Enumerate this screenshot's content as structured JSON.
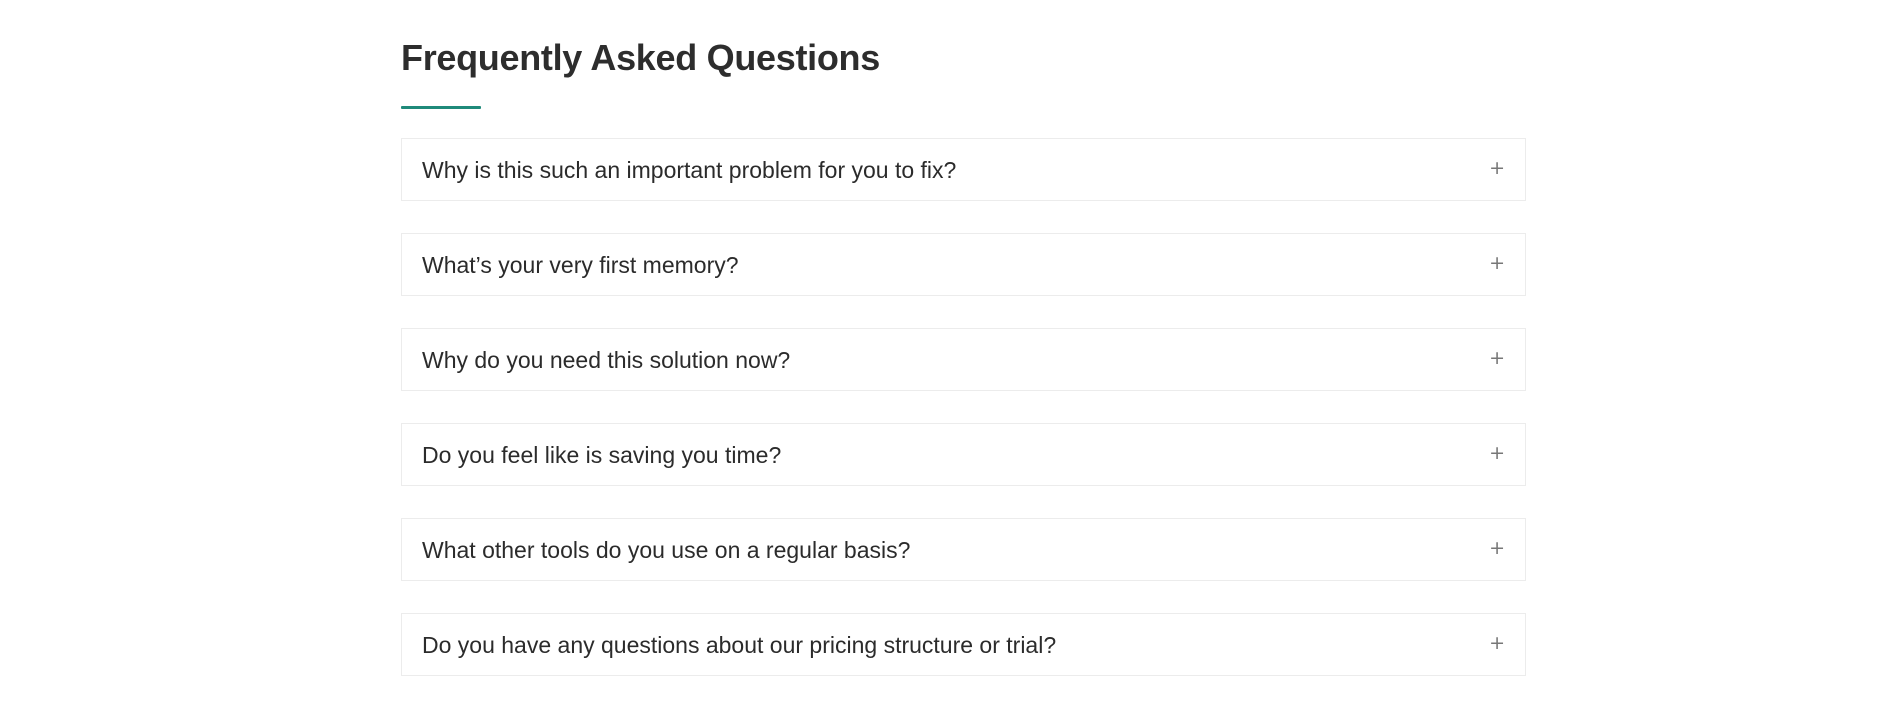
{
  "faq": {
    "title": "Frequently Asked Questions",
    "accent_color": "#1f8a7a",
    "toggle_symbol": "+",
    "items": [
      {
        "question": "Why is this such an important problem for you to fix?"
      },
      {
        "question": "What’s your very first memory?"
      },
      {
        "question": "Why do you need this solution now?"
      },
      {
        "question": "Do you feel like is saving you time?"
      },
      {
        "question": "What other tools do you use on a regular basis?"
      },
      {
        "question": "Do you have any questions about our pricing structure or trial?"
      }
    ]
  }
}
